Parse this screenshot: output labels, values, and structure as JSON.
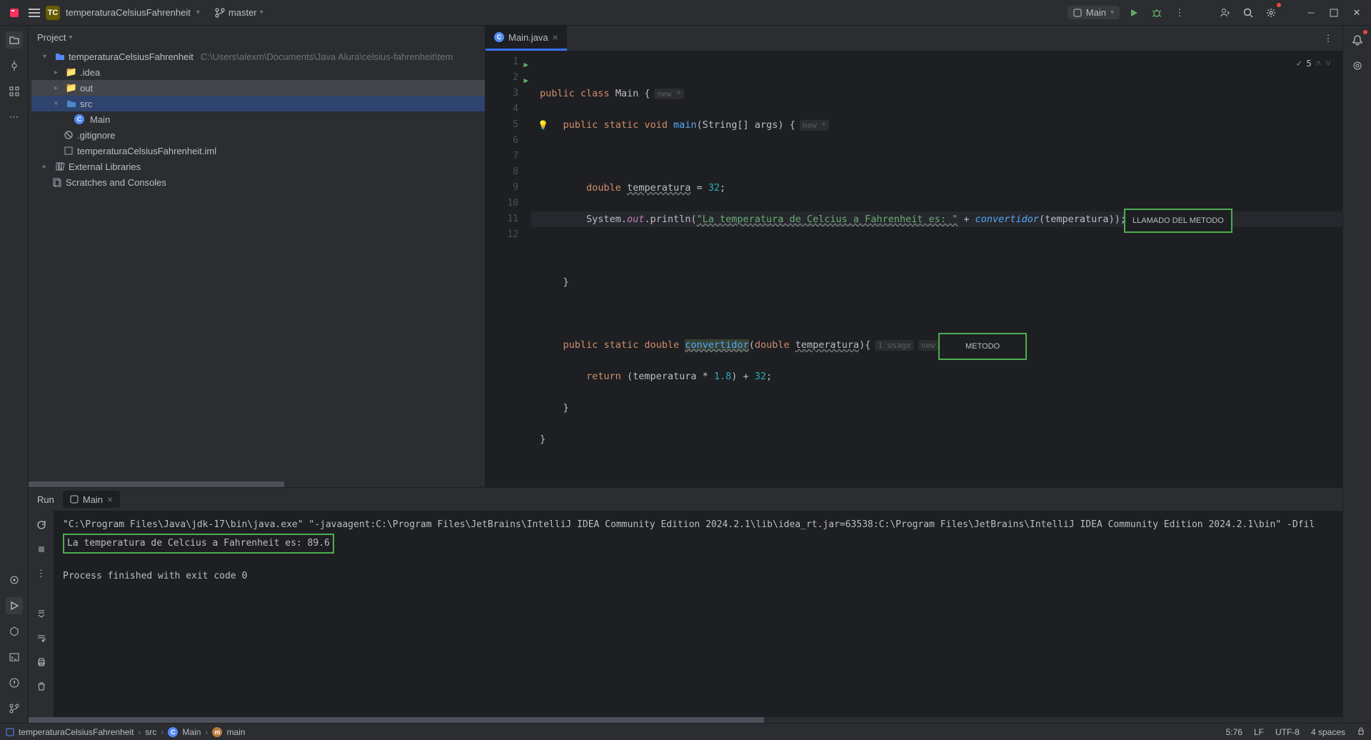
{
  "titlebar": {
    "project_badge": "TC",
    "project_name": "temperaturaCelsiusFahrenheit",
    "branch": "master",
    "run_config": "Main"
  },
  "project_panel": {
    "title": "Project",
    "root_name": "temperaturaCelsiusFahrenheit",
    "root_path": "C:\\Users\\alexm\\Documents\\Java Alura\\celsius-fahrenheit\\tem",
    "items": [
      {
        "label": ".idea",
        "type": "folder",
        "indent": 2
      },
      {
        "label": "out",
        "type": "folder",
        "indent": 2,
        "highlighted": true
      },
      {
        "label": "src",
        "type": "folder",
        "indent": 2,
        "expanded": true,
        "selected": true
      },
      {
        "label": "Main",
        "type": "class",
        "indent": 4
      },
      {
        "label": ".gitignore",
        "type": "gitignore",
        "indent": 2
      },
      {
        "label": "temperaturaCelsiusFahrenheit.iml",
        "type": "iml",
        "indent": 2
      }
    ],
    "external_libs": "External Libraries",
    "scratches": "Scratches and Consoles"
  },
  "editor": {
    "tab_name": "Main.java",
    "problems_count": "5",
    "lines": [
      {
        "n": "1",
        "runnable": true
      },
      {
        "n": "2",
        "runnable": true
      },
      {
        "n": "3"
      },
      {
        "n": "4"
      },
      {
        "n": "5",
        "current": true
      },
      {
        "n": "6"
      },
      {
        "n": "7"
      },
      {
        "n": "8"
      },
      {
        "n": "9"
      },
      {
        "n": "10"
      },
      {
        "n": "11"
      },
      {
        "n": "12"
      }
    ],
    "hints": {
      "new1": "new *",
      "new2": "new *",
      "usage": "1 usage",
      "new3": "new *"
    },
    "code": {
      "l1_public": "public",
      "l1_class": "class",
      "l1_Main": "Main",
      "l1_brace": " {",
      "l2_public": "public",
      "l2_static": "static",
      "l2_void": "void",
      "l2_main": "main",
      "l2_args": "(String[] args) {",
      "l4_double": "double",
      "l4_var": "temperatura",
      "l4_eq": " = ",
      "l4_val": "32",
      "l4_semi": ";",
      "l5_sys": "System.",
      "l5_out": "out",
      "l5_print": ".println(",
      "l5_str": "\"La temperatura de Celcius a Fahrenheit es: \"",
      "l5_plus": " + ",
      "l5_conv": "convertidor",
      "l5_arg": "(temperatura));",
      "l7_brace": "}",
      "l9_public": "public",
      "l9_static": "static",
      "l9_double": "double",
      "l9_conv": "convertidor",
      "l9_params": "(",
      "l9_pdouble": "double",
      "l9_pvar": "temperatura",
      "l9_end": "){",
      "l10_return": "return",
      "l10_expr1": " (temperatura * ",
      "l10_18": "1.8",
      "l10_expr2": ") + ",
      "l10_32": "32",
      "l10_semi": ";",
      "l11_brace": "}",
      "l12_brace": "}"
    },
    "annotations": {
      "llamado": "LLAMADO DEL METODO",
      "metodo": "METODO"
    }
  },
  "run_panel": {
    "title": "Run",
    "tab": "Main",
    "output_line1": "\"C:\\Program Files\\Java\\jdk-17\\bin\\java.exe\" \"-javaagent:C:\\Program Files\\JetBrains\\IntelliJ IDEA Community Edition 2024.2.1\\lib\\idea_rt.jar=63538:C:\\Program Files\\JetBrains\\IntelliJ IDEA Community Edition 2024.2.1\\bin\" -Dfil",
    "output_line2": "La temperatura de Celcius a Fahrenheit es: 89.6",
    "output_exit": "Process finished with exit code 0"
  },
  "status_bar": {
    "bc1": "temperaturaCelsiusFahrenheit",
    "bc2": "src",
    "bc3": "Main",
    "bc4": "main",
    "pos": "5:76",
    "line_sep": "LF",
    "encoding": "UTF-8",
    "indent": "4 spaces"
  }
}
